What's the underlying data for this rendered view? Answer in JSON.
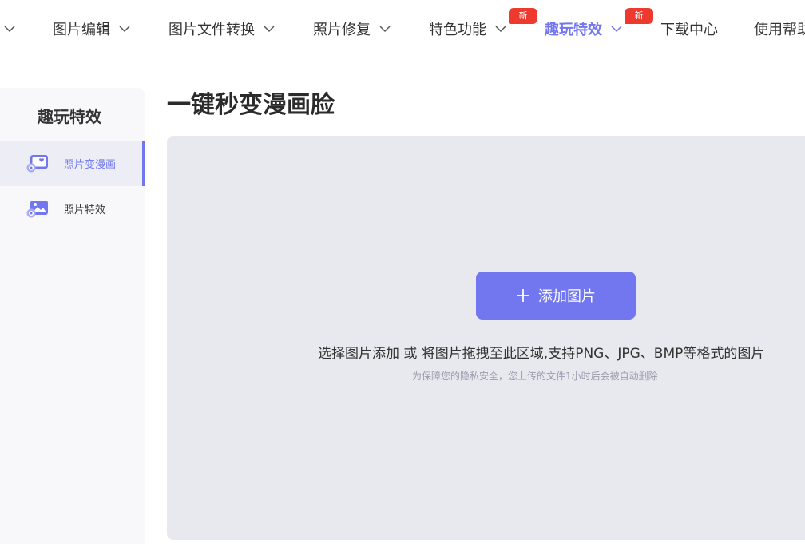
{
  "nav": {
    "items": [
      {
        "label": "图片编辑"
      },
      {
        "label": "图片文件转换"
      },
      {
        "label": "照片修复"
      },
      {
        "label": "特色功能",
        "badge": "新"
      },
      {
        "label": "趣玩特效",
        "badge": "新",
        "active": true
      },
      {
        "label": "下载中心"
      },
      {
        "label": "使用帮助"
      }
    ]
  },
  "sidebar": {
    "title": "趣玩特效",
    "items": [
      {
        "label": "照片变漫画",
        "icon": "photo-cartoon-icon",
        "active": true
      },
      {
        "label": "照片特效",
        "icon": "photo-effect-icon"
      }
    ]
  },
  "main": {
    "title": "一键秒变漫画脸",
    "add_button": "添加图片",
    "hint": "选择图片添加 或 将图片拖拽至此区域,支持PNG、JPG、BMP等格式的图片",
    "privacy": "为保障您的隐私安全，您上传的文件1小时后会被自动删除"
  },
  "colors": {
    "accent": "#7277f0",
    "badge": "#ee3a2e",
    "dropzone": "#e7e9ef",
    "sidebar_bg": "#f8f8fb"
  }
}
